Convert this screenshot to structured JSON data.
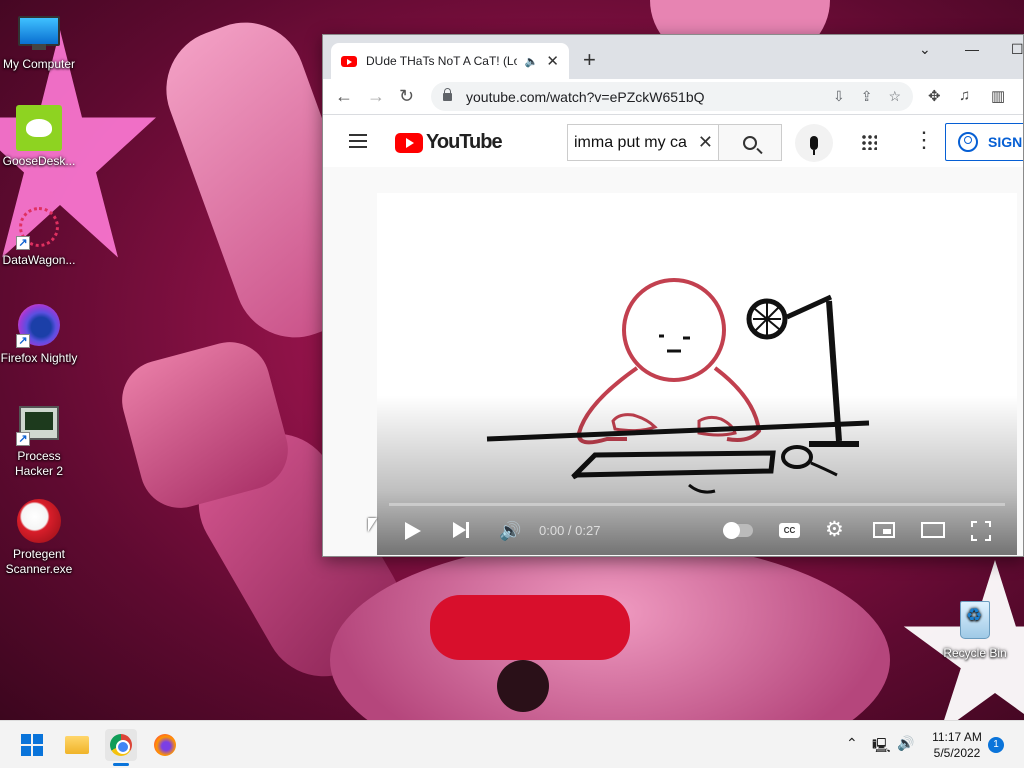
{
  "desktop": {
    "icons": [
      {
        "label": "My Computer"
      },
      {
        "label": "GooseDesk..."
      },
      {
        "label": "DataWagon..."
      },
      {
        "label": "Firefox Nightly"
      },
      {
        "label": "Process Hacker 2"
      },
      {
        "label": "Protegent Scanner.exe"
      },
      {
        "label": "Recycle Bin"
      }
    ]
  },
  "browser": {
    "tab": {
      "title": "DUde THaTs NoT A CaT! (Lo",
      "speaker_icon": "speaker-icon",
      "close": "✕"
    },
    "new_tab": "+",
    "window_controls": {
      "dropdown": "⌄",
      "minimize": "—",
      "maximize": "☐"
    },
    "nav": {
      "back": "←",
      "forward": "→",
      "reload": "↻"
    },
    "url": "youtube.com/watch?v=ePZckW651bQ"
  },
  "youtube": {
    "logo_text": "YouTube",
    "search_query": "imma put my ca",
    "search_clear": "✕",
    "signin_label": "SIGN",
    "kebab": "⋮"
  },
  "player": {
    "time": "0:00 / 0:27",
    "progress": 0.0,
    "cc_label": "CC",
    "volume_icon": "🔊",
    "settings_icon": "⚙"
  },
  "taskbar": {
    "apps": [
      "start",
      "file-explorer",
      "chrome",
      "firefox"
    ],
    "tray": {
      "chevron": "⌃",
      "network": "🖳",
      "volume": "🔊"
    },
    "clock_time": "11:17 AM",
    "clock_date": "5/5/2022",
    "notification_count": "1"
  },
  "colors": {
    "youtube_red": "#ff0000",
    "accent_blue": "#065fd4",
    "windows_blue": "#0a74da"
  }
}
